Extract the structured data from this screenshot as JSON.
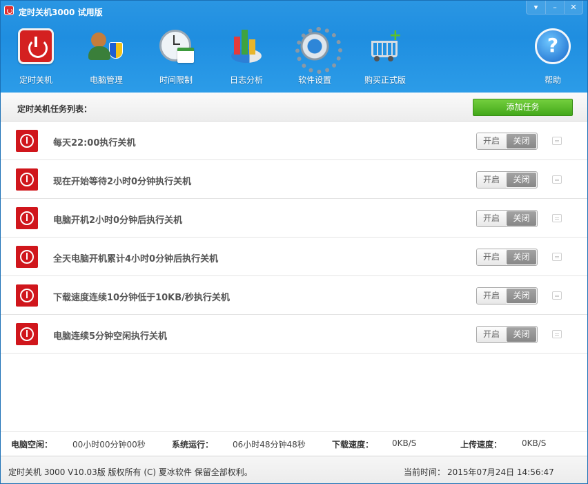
{
  "window": {
    "title": "定时关机3000 试用版",
    "controls": [
      "▾",
      "–",
      "✕"
    ]
  },
  "toolbar": {
    "items": [
      {
        "label": "定时关机",
        "icon": "power-icon"
      },
      {
        "label": "电脑管理",
        "icon": "computer-manage-icon"
      },
      {
        "label": "时间限制",
        "icon": "clock-calendar-icon"
      },
      {
        "label": "日志分析",
        "icon": "chart-icon"
      },
      {
        "label": "软件设置",
        "icon": "gear-icon"
      },
      {
        "label": "购买正式版",
        "icon": "cart-icon"
      },
      {
        "label": "帮助",
        "icon": "help-icon"
      }
    ]
  },
  "list": {
    "title": "定时关机任务列表：",
    "add_button": "添加任务",
    "toggle_on": "开启",
    "toggle_off": "关闭",
    "tasks": [
      {
        "text": "每天22:00执行关机",
        "state": "off"
      },
      {
        "text": "现在开始等待2小时0分钟执行关机",
        "state": "off"
      },
      {
        "text": "电脑开机2小时0分钟后执行关机",
        "state": "off"
      },
      {
        "text": "全天电脑开机累计4小时0分钟后执行关机",
        "state": "off"
      },
      {
        "text": "下载速度连续10分钟低于10KB/秒执行关机",
        "state": "off"
      },
      {
        "text": "电脑连续5分钟空闲执行关机",
        "state": "off"
      }
    ]
  },
  "stats": {
    "idle_label": "电脑空闲：",
    "idle_value": "00小时00分钟00秒",
    "uptime_label": "系统运行：",
    "uptime_value": "06小时48分钟48秒",
    "download_label": "下载速度：",
    "download_value": "0KB/S",
    "upload_label": "上传速度：",
    "upload_value": "0KB/S"
  },
  "footer": {
    "copyright": "定时关机 3000 V10.03版  版权所有 (C)  夏冰软件 保留全部权利。",
    "time_label": "当前时间：",
    "time_value": "2015年07月24日 14:56:47"
  },
  "colors": {
    "header_blue": "#2a96e3",
    "add_green": "#4fb323",
    "task_red": "#d0161c"
  }
}
